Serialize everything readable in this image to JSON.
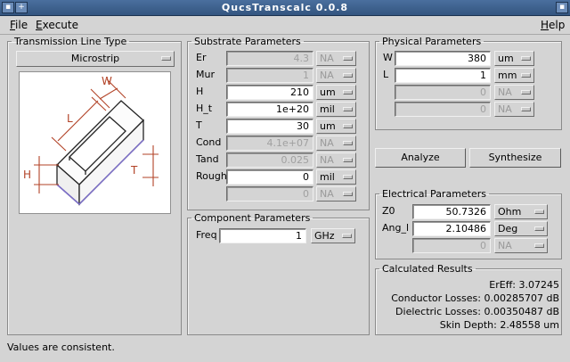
{
  "window": {
    "title": "QucsTranscalc 0.0.8"
  },
  "menu": {
    "file": "ile",
    "file_key": "F",
    "execute": "xecute",
    "execute_key": "E",
    "help": "elp",
    "help_key": "H"
  },
  "line_type": {
    "legend": "Transmission Line Type",
    "selected": "Microstrip"
  },
  "diagram": {
    "w": "W",
    "l": "L",
    "h": "H",
    "t": "T"
  },
  "substrate": {
    "legend": "Substrate Parameters",
    "rows": [
      {
        "label": "Er",
        "value": "4.3",
        "unit": "NA",
        "enabled": false
      },
      {
        "label": "Mur",
        "value": "1",
        "unit": "NA",
        "enabled": false
      },
      {
        "label": "H",
        "value": "210",
        "unit": "um",
        "enabled": true
      },
      {
        "label": "H_t",
        "value": "1e+20",
        "unit": "mil",
        "enabled": true
      },
      {
        "label": "T",
        "value": "30",
        "unit": "um",
        "enabled": true
      },
      {
        "label": "Cond",
        "value": "4.1e+07",
        "unit": "NA",
        "enabled": false
      },
      {
        "label": "Tand",
        "value": "0.025",
        "unit": "NA",
        "enabled": false
      },
      {
        "label": "Rough",
        "value": "0",
        "unit": "mil",
        "enabled": true
      },
      {
        "label": "",
        "value": "0",
        "unit": "NA",
        "enabled": false
      }
    ]
  },
  "component": {
    "legend": "Component Parameters",
    "label": "Freq",
    "value": "1",
    "unit": "GHz"
  },
  "physical": {
    "legend": "Physical Parameters",
    "rows": [
      {
        "label": "W",
        "value": "380",
        "unit": "um",
        "enabled": true
      },
      {
        "label": "L",
        "value": "1",
        "unit": "mm",
        "enabled": true
      },
      {
        "label": "",
        "value": "0",
        "unit": "NA",
        "enabled": false
      },
      {
        "label": "",
        "value": "0",
        "unit": "NA",
        "enabled": false
      }
    ]
  },
  "actions": {
    "analyze": "Analyze",
    "synthesize": "Synthesize"
  },
  "electrical": {
    "legend": "Electrical Parameters",
    "rows": [
      {
        "label": "Z0",
        "value": "50.7326",
        "unit": "Ohm",
        "enabled": true
      },
      {
        "label": "Ang_l",
        "value": "2.10486",
        "unit": "Deg",
        "enabled": true
      },
      {
        "label": "",
        "value": "0",
        "unit": "NA",
        "enabled": false
      }
    ]
  },
  "results": {
    "legend": "Calculated Results",
    "lines": [
      "ErEff: 3.07245",
      "Conductor Losses: 0.00285707 dB",
      "Dielectric Losses: 0.00350487 dB",
      "Skin Depth: 2.48558 um"
    ]
  },
  "status": "Values are consistent."
}
